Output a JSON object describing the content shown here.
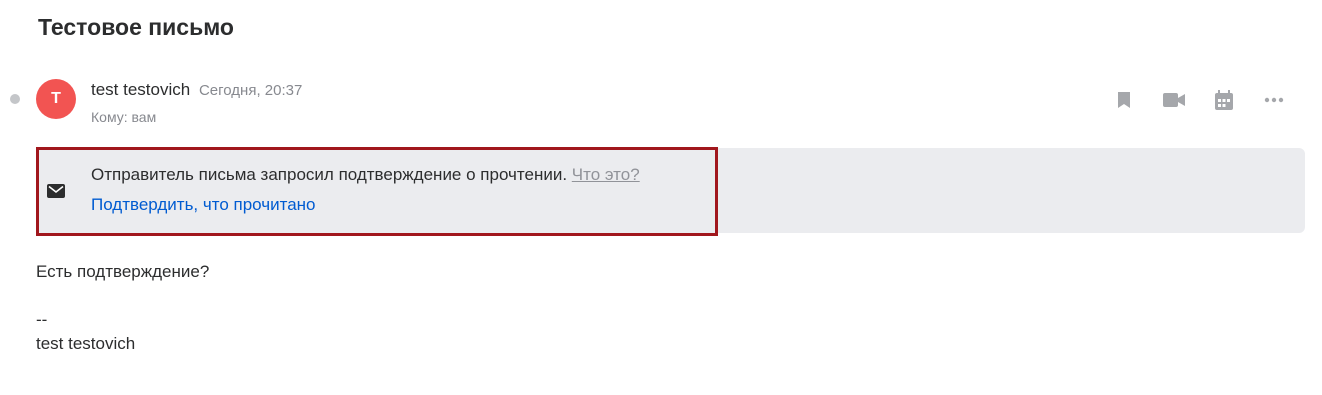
{
  "subject": "Тестовое письмо",
  "sender": {
    "avatar_letter": "T",
    "avatar_color": "#f25452",
    "name": "test testovich",
    "time": "Сегодня, 20:37",
    "to": "Кому: вам"
  },
  "toolbar": {
    "icons": [
      "bookmark-icon",
      "video-icon",
      "calendar-icon",
      "more-icon"
    ]
  },
  "read_receipt": {
    "message": "Отправитель письма запросил подтверждение о прочтении.",
    "help_link": "Что это?",
    "confirm_link": "Подтвердить, что прочитано",
    "icon": "envelope-icon",
    "highlight_color": "#a1171d"
  },
  "body": {
    "line1": "Есть подтверждение?",
    "line2": "",
    "signature_sep": "--",
    "signature_name": "test testovich"
  }
}
